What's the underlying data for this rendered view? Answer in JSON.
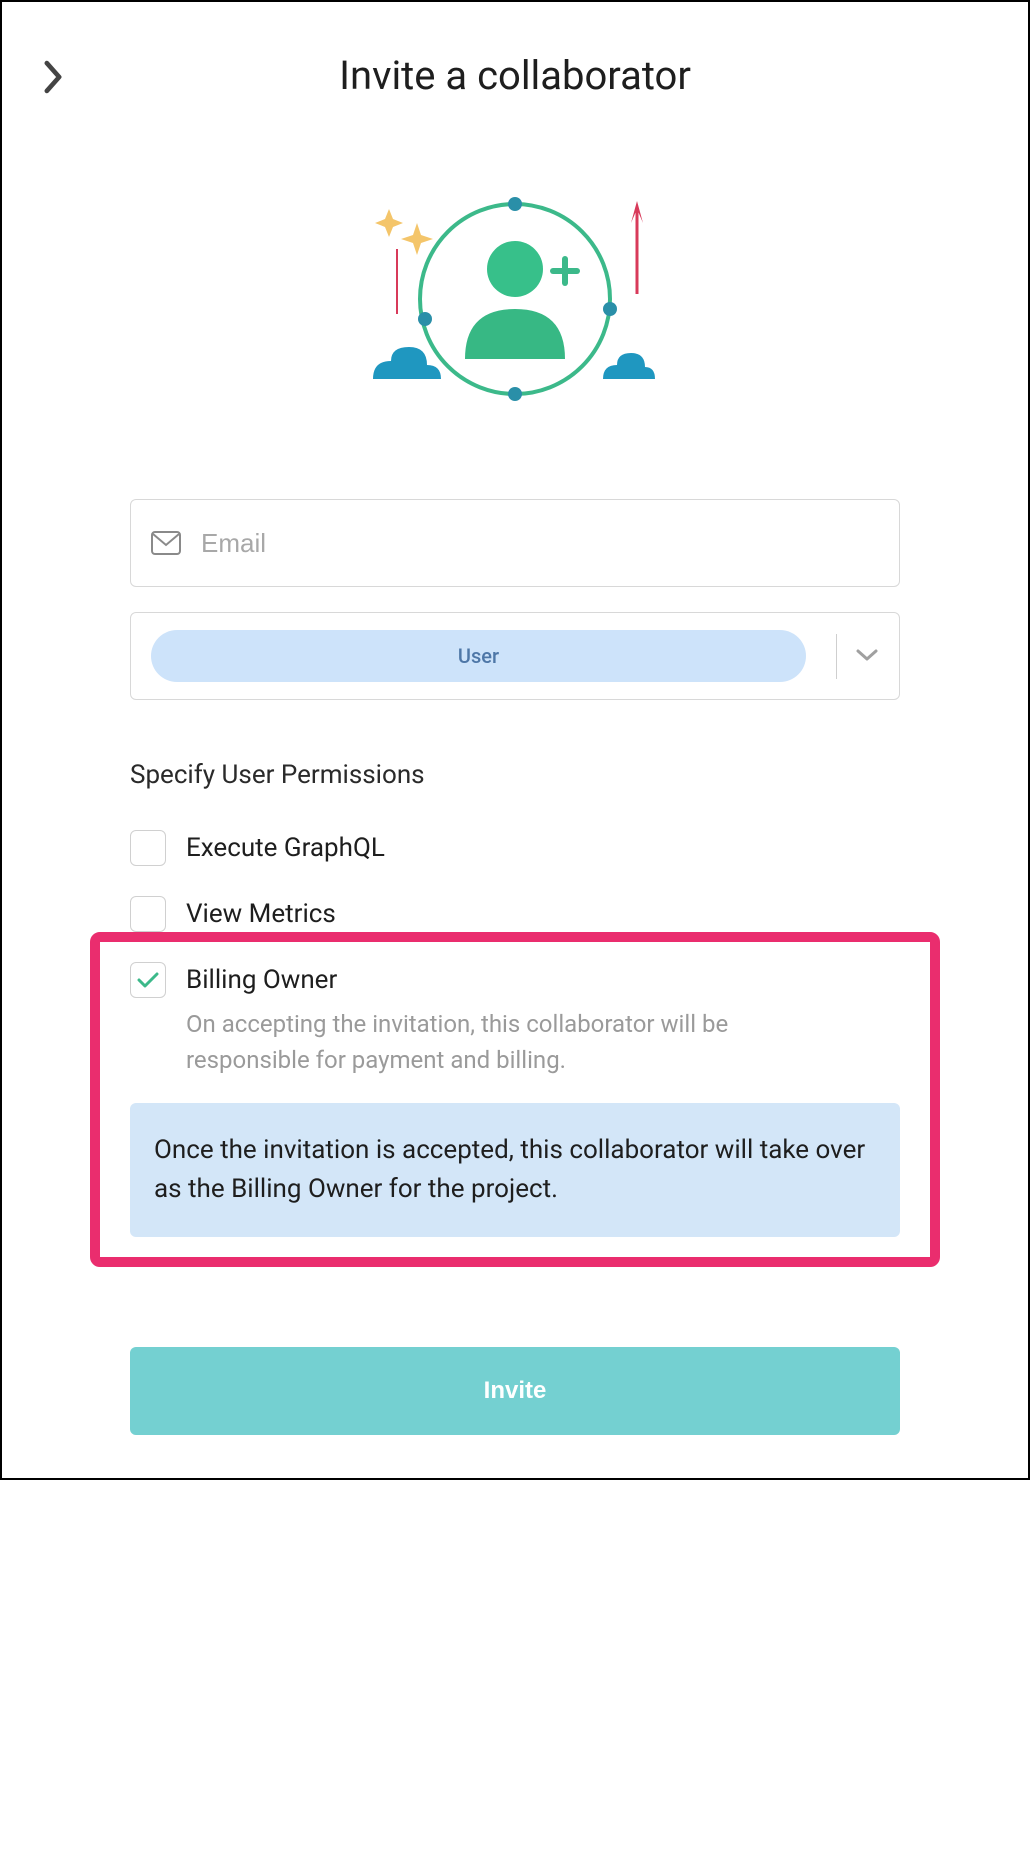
{
  "header": {
    "title": "Invite a collaborator"
  },
  "form": {
    "email_placeholder": "Email",
    "role_selected": "User"
  },
  "permissions": {
    "section_label": "Specify User Permissions",
    "items": [
      {
        "label": "Execute GraphQL",
        "checked": false,
        "desc": ""
      },
      {
        "label": "View Metrics",
        "checked": false,
        "desc": ""
      },
      {
        "label": "Billing Owner",
        "checked": true,
        "desc": "On accepting the invitation, this collaborator will be responsible for payment and billing."
      }
    ],
    "info_text": "Once the invitation is accepted, this collaborator will take over as the Billing Owner for the project."
  },
  "actions": {
    "invite_label": "Invite"
  }
}
